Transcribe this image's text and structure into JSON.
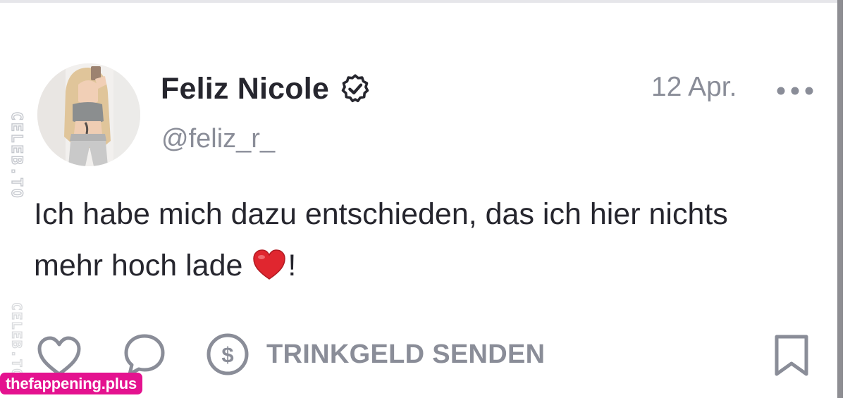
{
  "post": {
    "author_name": "Feliz Nicole",
    "author_handle": "@feliz_r_",
    "date": "12 Apr.",
    "text_line1": "Ich habe mich dazu entschieden, das ich hier nichts",
    "text_line2_before_emoji": "mehr hoch lade ",
    "text_line2_after_emoji": "!",
    "verified": true
  },
  "actions": {
    "tip_label": "TRINKGELD SENDEN"
  },
  "icons": {
    "more": "more-dots-icon",
    "verified": "verified-badge-icon",
    "like": "heart-outline-icon",
    "comment": "comment-bubble-icon",
    "tip": "dollar-circle-icon",
    "bookmark": "bookmark-icon",
    "emoji": "red-heart-emoji"
  },
  "watermarks": {
    "vertical_text": "CELEB.TO",
    "pill_text": "thefappening.plus"
  },
  "colors": {
    "text_primary": "#26262e",
    "text_secondary": "#8a8d98",
    "icon_gray": "#8a8d98",
    "watermark_pink": "#e4128f",
    "heart_red": "#e0262f"
  }
}
